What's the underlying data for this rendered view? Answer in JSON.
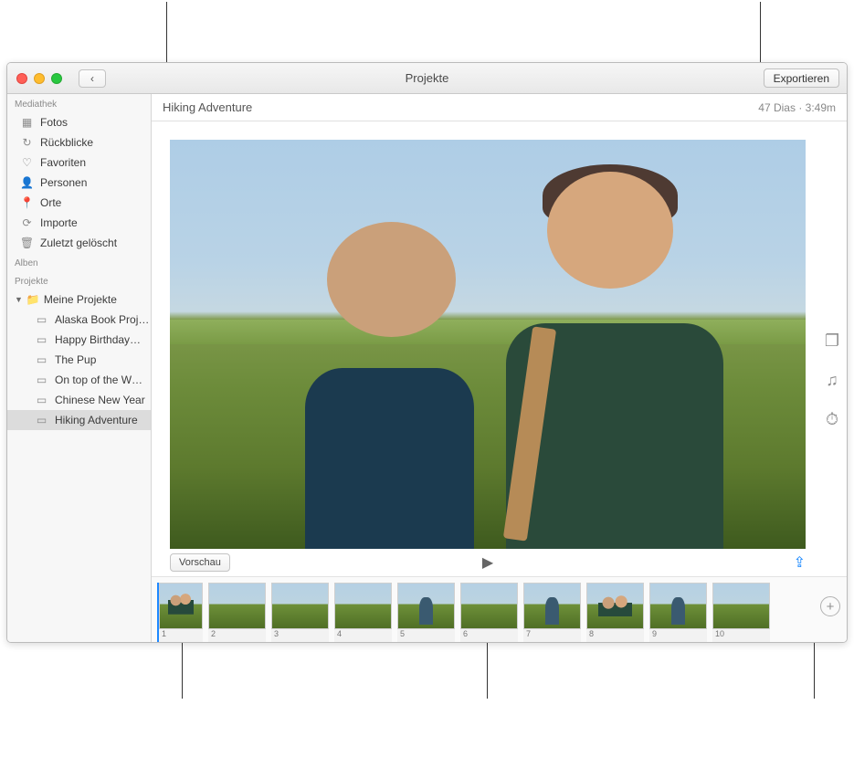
{
  "titlebar": {
    "title": "Projekte",
    "export_label": "Exportieren"
  },
  "sidebar": {
    "section_mediathek": "Mediathek",
    "items_mediathek": [
      {
        "icon": "photos",
        "label": "Fotos"
      },
      {
        "icon": "clock",
        "label": "Rückblicke"
      },
      {
        "icon": "heart",
        "label": "Favoriten"
      },
      {
        "icon": "person",
        "label": "Personen"
      },
      {
        "icon": "pin",
        "label": "Orte"
      },
      {
        "icon": "download",
        "label": "Importe"
      },
      {
        "icon": "trash",
        "label": "Zuletzt gelöscht"
      }
    ],
    "section_alben": "Alben",
    "section_projekte": "Projekte",
    "folder_label": "Meine Projekte",
    "projects": [
      "Alaska Book Proj…",
      "Happy Birthday…",
      "The Pup",
      "On top of the W…",
      "Chinese New Year",
      "Hiking Adventure"
    ]
  },
  "project": {
    "title": "Hiking Adventure",
    "meta": "47 Dias · 3:49m"
  },
  "controls": {
    "preview_label": "Vorschau"
  },
  "thumbs": [
    "1",
    "2",
    "3",
    "4",
    "5",
    "6",
    "7",
    "8",
    "9",
    "10"
  ]
}
